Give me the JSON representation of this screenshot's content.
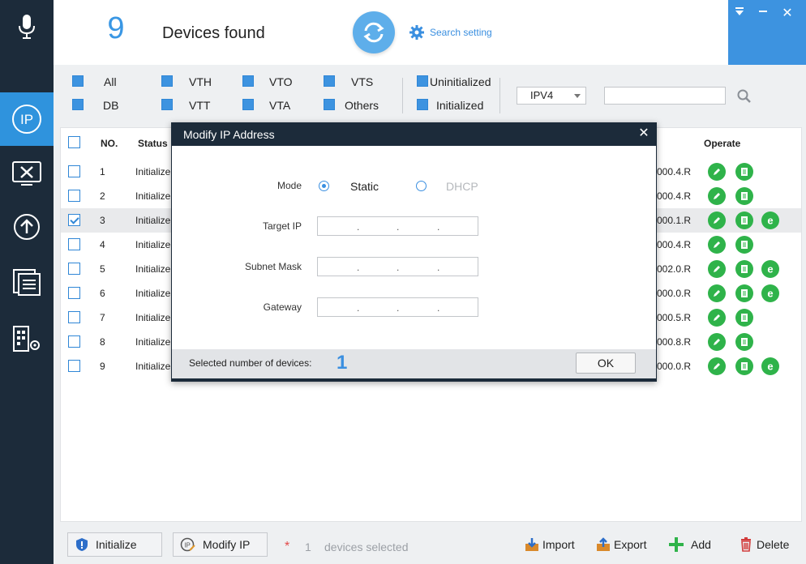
{
  "header": {
    "device_count": "9",
    "devices_found_label": "Devices found",
    "search_setting_label": "Search setting"
  },
  "window_controls": {
    "menu": "▼",
    "minimize": "—",
    "close": "✕"
  },
  "sidebar": {
    "items": [
      {
        "icon": "microphone-icon"
      },
      {
        "icon": "ip-icon",
        "active": true
      },
      {
        "icon": "tools-icon"
      },
      {
        "icon": "upgrade-icon"
      },
      {
        "icon": "documents-icon"
      },
      {
        "icon": "building-settings-icon"
      }
    ]
  },
  "filters": {
    "row1": [
      "All",
      "VTH",
      "VTO",
      "VTS",
      "Uninitialized"
    ],
    "row2": [
      "DB",
      "VTT",
      "VTA",
      "Others",
      "Initialized"
    ],
    "ip_version": "IPV4",
    "search_value": ""
  },
  "table": {
    "headers": {
      "no": "NO.",
      "status": "Status",
      "operate": "Operate"
    },
    "rows": [
      {
        "no": "1",
        "status": "Initialize",
        "version": "000.4.R",
        "checked": false,
        "browser": false
      },
      {
        "no": "2",
        "status": "Initialize",
        "version": "000.4.R",
        "checked": false,
        "browser": false
      },
      {
        "no": "3",
        "status": "Initialize",
        "version": "000.1.R",
        "checked": true,
        "browser": true
      },
      {
        "no": "4",
        "status": "Initialize",
        "version": "000.4.R",
        "checked": false,
        "browser": false
      },
      {
        "no": "5",
        "status": "Initialize",
        "version": "002.0.R",
        "checked": false,
        "browser": true
      },
      {
        "no": "6",
        "status": "Initialize",
        "version": "000.0.R",
        "checked": false,
        "browser": true
      },
      {
        "no": "7",
        "status": "Initialize",
        "version": "000.5.R",
        "checked": false,
        "browser": false
      },
      {
        "no": "8",
        "status": "Initialize",
        "version": "000.8.R",
        "checked": false,
        "browser": false
      },
      {
        "no": "9",
        "status": "Initialize",
        "version": "000.0.R",
        "checked": false,
        "browser": true
      }
    ]
  },
  "modal": {
    "title": "Modify IP Address",
    "close": "✕",
    "mode_label": "Mode",
    "static_label": "Static",
    "dhcp_label": "DHCP",
    "target_ip_label": "Target IP",
    "subnet_mask_label": "Subnet Mask",
    "gateway_label": "Gateway",
    "selected_label": "Selected number of devices:",
    "selected_count": "1",
    "ok_label": "OK"
  },
  "bottom": {
    "initialize_label": "Initialize",
    "modify_ip_label": "Modify IP",
    "asterisk": "*",
    "selected_count": "1",
    "devices_selected_label": "devices selected",
    "import_label": "Import",
    "export_label": "Export",
    "add_label": "Add",
    "delete_label": "Delete"
  },
  "colors": {
    "sidebar": "#1c2b3a",
    "accent": "#3d93e0",
    "operate_green": "#2fb34a",
    "count_blue": "#3a97e4"
  }
}
